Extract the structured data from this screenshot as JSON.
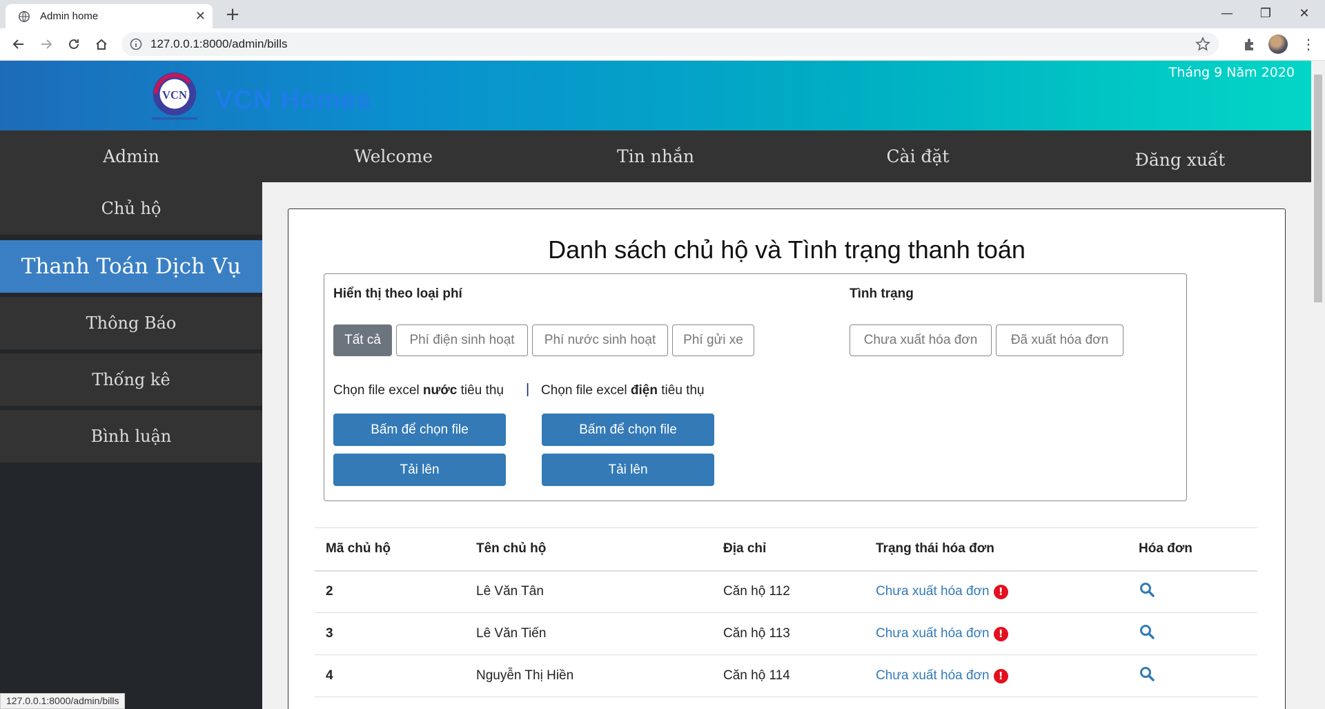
{
  "browser": {
    "tab_title": "Admin home",
    "url": "127.0.0.1:8000/admin/bills",
    "status_url": "127.0.0.1:8000/admin/bills"
  },
  "header": {
    "brand": "VCN Homes",
    "logo_text": "VCN",
    "date": "Tháng 9 Năm 2020",
    "gradient_start": "#1d6bb8",
    "gradient_end": "#02d6c6"
  },
  "topnav": [
    "Admin",
    "Welcome",
    "Tin nhắn",
    "Cài đặt",
    "Đăng xuất"
  ],
  "sidebar": {
    "items": [
      "Chủ hộ",
      "Thanh Toán Dịch Vụ",
      "Thông Báo",
      "Thống kê",
      "Bình luận"
    ],
    "active_index": 1,
    "active_color": "#3a7fc4"
  },
  "main": {
    "title": "Danh sách chủ hộ và Tình trạng thanh toán",
    "fee_filter_label": "Hiển thị theo loại phí",
    "fee_filters": [
      "Tất cả",
      "Phí điện sinh hoạt",
      "Phí nước sinh hoạt",
      "Phí gửi xe"
    ],
    "status_label": "Tình trạng",
    "status_filters": [
      "Chưa xuất hóa đơn",
      "Đã xuất hóa đơn"
    ],
    "water_file": {
      "pre": "Chọn file excel ",
      "bold": "nước",
      "post": " tiêu thụ"
    },
    "elec_file": {
      "pre": "Chọn file excel ",
      "bold": "điện",
      "post": " tiêu thụ"
    },
    "separator": "|",
    "choose_file": "Bấm để chọn file",
    "upload": "Tải lên"
  },
  "table": {
    "headers": [
      "Mã chủ hộ",
      "Tên chủ hộ",
      "Địa chỉ",
      "Trạng thái hóa đơn",
      "Hóa đơn"
    ],
    "rows": [
      {
        "id": "2",
        "name": "Lê Văn Tân",
        "address": "Căn hộ 112",
        "status": "Chưa xuất hóa đơn"
      },
      {
        "id": "3",
        "name": "Lê Văn Tiến",
        "address": "Căn hộ 113",
        "status": "Chưa xuất hóa đơn"
      },
      {
        "id": "4",
        "name": "Nguyễn Thị Hiền",
        "address": "Căn hộ 114",
        "status": "Chưa xuất hóa đơn"
      }
    ]
  }
}
